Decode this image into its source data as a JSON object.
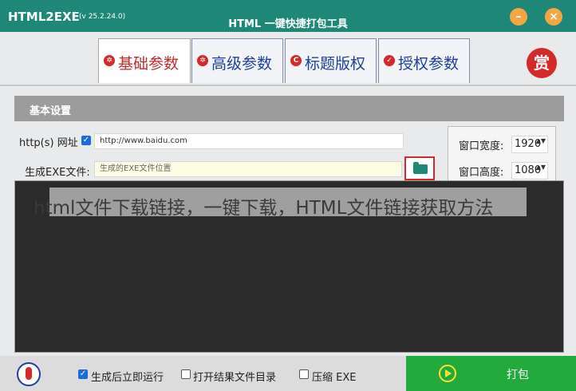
{
  "titlebar": {
    "app_name": "HTML2EXE",
    "version": "(v 25.2.24.0)",
    "window_title": "HTML 一键快捷打包工具",
    "minimize_glyph": "–",
    "close_glyph": "×"
  },
  "tabs": [
    {
      "label": "基础参数",
      "icon": "gear-icon",
      "icon_glyph": "✲",
      "active": true
    },
    {
      "label": "高级参数",
      "icon": "gear-icon",
      "icon_glyph": "✲",
      "active": false
    },
    {
      "label": "标题版权",
      "icon": "copyright-icon",
      "icon_glyph": "C",
      "active": false
    },
    {
      "label": "授权参数",
      "icon": "shield-icon",
      "icon_glyph": "✓",
      "active": false
    }
  ],
  "reward_label": "赏",
  "section_title": "基本设置",
  "form": {
    "url_label": "http(s) 网址",
    "url_checked": true,
    "url_value": "http://www.baidu.com",
    "exe_label": "生成EXE文件:",
    "exe_placeholder": "生成的EXE文件位置"
  },
  "window_size": {
    "width_label": "窗口宽度:",
    "width_value": "1920",
    "height_label": "窗口高度:",
    "height_value": "1080",
    "spin_arrows": "▲▼"
  },
  "overlay_caption": "html文件下载链接，一键下载，HTML文件链接获取方法",
  "bottom": {
    "options": [
      {
        "label": "生成后立即运行",
        "checked": true
      },
      {
        "label": "打开结果文件目录",
        "checked": false
      },
      {
        "label": "压缩 EXE",
        "checked": false
      }
    ],
    "pack_label": "打包"
  },
  "colors": {
    "accent": "#1e8777",
    "active_tab_text": "#c42a2a",
    "tab_text": "#1f3f9e",
    "pack_button": "#22aa3c",
    "log_area": "#2b2b2b"
  }
}
